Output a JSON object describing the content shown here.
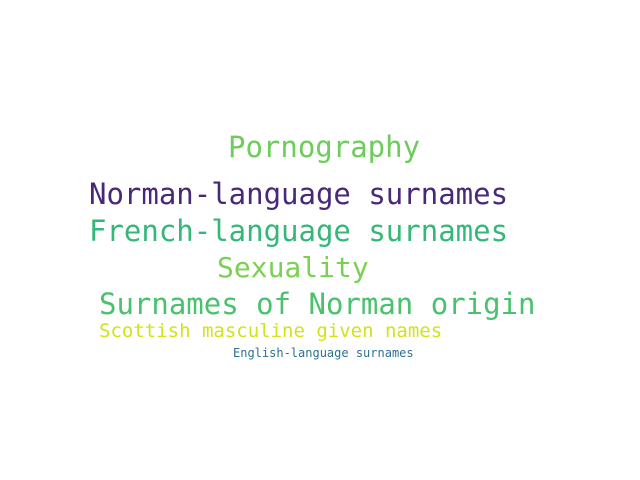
{
  "word_cloud": {
    "words": [
      {
        "text": "Pornography",
        "color": "#6ccd5a"
      },
      {
        "text": "Norman-language surnames",
        "color": "#482878"
      },
      {
        "text": "French-language surnames",
        "color": "#35b779"
      },
      {
        "text": "Sexuality",
        "color": "#7ad151"
      },
      {
        "text": "Surnames of Norman origin",
        "color": "#4ac16d"
      },
      {
        "text": "Scottish masculine given names",
        "color": "#d2e21b"
      },
      {
        "text": "English-language surnames",
        "color": "#2c728e"
      }
    ]
  }
}
